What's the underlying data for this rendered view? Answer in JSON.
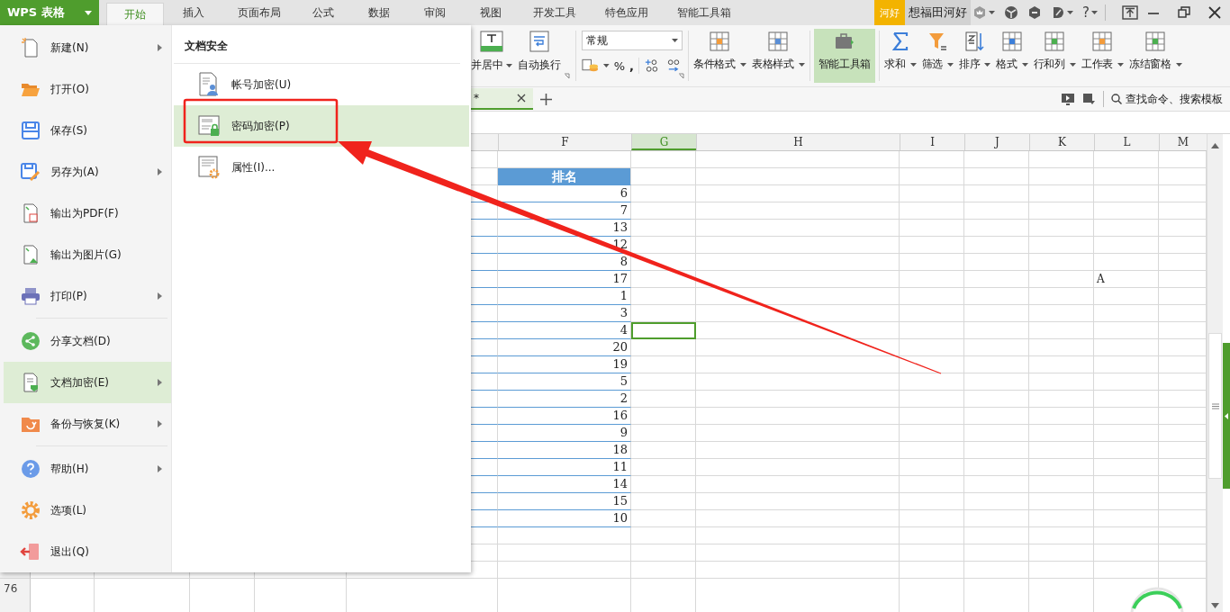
{
  "app_menu": {
    "label": "WPS 表格"
  },
  "tabs": [
    {
      "label": "开始",
      "selected": true
    },
    {
      "label": "插入",
      "selected": false
    },
    {
      "label": "页面布局",
      "selected": false
    },
    {
      "label": "公式",
      "selected": false
    },
    {
      "label": "数据",
      "selected": false
    },
    {
      "label": "审阅",
      "selected": false
    },
    {
      "label": "视图",
      "selected": false
    },
    {
      "label": "开发工具",
      "selected": false
    },
    {
      "label": "特色应用",
      "selected": false
    },
    {
      "label": "智能工具箱",
      "selected": false
    }
  ],
  "account": {
    "badge": "河好",
    "name": "想福田河好",
    "help": "?"
  },
  "ribbon": {
    "merge_center": "并居中",
    "wrap_text": "自动换行",
    "number_format": "常规",
    "percent": "%",
    "comma": ",",
    "buttons": [
      {
        "label": "条件格式",
        "dropdown": true,
        "highlighted": false
      },
      {
        "label": "表格样式",
        "dropdown": true,
        "highlighted": false
      },
      {
        "label": "智能工具箱",
        "dropdown": false,
        "highlighted": true
      },
      {
        "label": "求和",
        "dropdown": true,
        "highlighted": false
      },
      {
        "label": "筛选",
        "dropdown": true,
        "highlighted": false
      },
      {
        "label": "排序",
        "dropdown": true,
        "highlighted": false
      },
      {
        "label": "格式",
        "dropdown": true,
        "highlighted": false
      },
      {
        "label": "行和列",
        "dropdown": true,
        "highlighted": false
      },
      {
        "label": "工作表",
        "dropdown": true,
        "highlighted": false
      },
      {
        "label": "冻结窗格",
        "dropdown": true,
        "highlighted": false
      }
    ]
  },
  "doc_tab": {
    "title": "*",
    "selected": true
  },
  "search": {
    "placeholder": "查找命令、搜索模板"
  },
  "sheet": {
    "columns": [
      {
        "label": "F",
        "selected": false
      },
      {
        "label": "G",
        "selected": true
      },
      {
        "label": "H",
        "selected": false
      },
      {
        "label": "I",
        "selected": false
      },
      {
        "label": "J",
        "selected": false
      },
      {
        "label": "K",
        "selected": false
      },
      {
        "label": "L",
        "selected": false
      },
      {
        "label": "M",
        "selected": false
      }
    ],
    "rows": [
      {
        "kind": "blank",
        "cursor": false
      },
      {
        "kind": "header",
        "F": "排名",
        "cursor": false
      },
      {
        "kind": "data",
        "F": "6",
        "cursor": false
      },
      {
        "kind": "data",
        "F": "7",
        "cursor": false
      },
      {
        "kind": "data",
        "F": "13",
        "cursor": false
      },
      {
        "kind": "data",
        "F": "12",
        "cursor": false
      },
      {
        "kind": "data",
        "F": "8",
        "cursor": false
      },
      {
        "kind": "data",
        "F": "17",
        "L": "A",
        "cursor": false
      },
      {
        "kind": "data",
        "F": "1",
        "cursor": false
      },
      {
        "kind": "data",
        "F": "3",
        "cursor": false
      },
      {
        "kind": "data",
        "F": "4",
        "cursor": true
      },
      {
        "kind": "data",
        "F": "20",
        "cursor": false
      },
      {
        "kind": "data",
        "F": "19",
        "cursor": false
      },
      {
        "kind": "data",
        "F": "5",
        "cursor": false
      },
      {
        "kind": "data",
        "F": "2",
        "cursor": false
      },
      {
        "kind": "data",
        "F": "16",
        "cursor": false
      },
      {
        "kind": "data",
        "F": "9",
        "cursor": false
      },
      {
        "kind": "data",
        "F": "18",
        "cursor": false
      },
      {
        "kind": "data",
        "F": "11",
        "cursor": false
      },
      {
        "kind": "data",
        "F": "14",
        "cursor": false
      },
      {
        "kind": "data",
        "F": "15",
        "cursor": false
      },
      {
        "kind": "data",
        "F": "10",
        "cursor": false
      },
      {
        "kind": "blank",
        "cursor": false
      },
      {
        "kind": "blank",
        "cursor": false
      },
      {
        "kind": "blank",
        "cursor": false
      },
      {
        "kind": "blank",
        "number": "76",
        "cursor": false
      }
    ]
  },
  "file_menu": {
    "items": [
      {
        "label": "新建(N)",
        "submenu": true,
        "selected": false,
        "divider_before": false
      },
      {
        "label": "打开(O)",
        "submenu": false,
        "selected": false,
        "divider_before": false
      },
      {
        "label": "保存(S)",
        "submenu": false,
        "selected": false,
        "divider_before": false
      },
      {
        "label": "另存为(A)",
        "submenu": true,
        "selected": false,
        "divider_before": false
      },
      {
        "label": "输出为PDF(F)",
        "submenu": false,
        "selected": false,
        "divider_before": false
      },
      {
        "label": "输出为图片(G)",
        "submenu": false,
        "selected": false,
        "divider_before": false
      },
      {
        "label": "打印(P)",
        "submenu": true,
        "selected": false,
        "divider_before": false
      },
      {
        "label": "分享文档(D)",
        "submenu": false,
        "selected": false,
        "divider_before": true
      },
      {
        "label": "文档加密(E)",
        "submenu": true,
        "selected": true,
        "divider_before": false
      },
      {
        "label": "备份与恢复(K)",
        "submenu": true,
        "selected": false,
        "divider_before": false
      },
      {
        "label": "帮助(H)",
        "submenu": true,
        "selected": false,
        "divider_before": true
      },
      {
        "label": "选项(L)",
        "submenu": false,
        "selected": false,
        "divider_before": false
      },
      {
        "label": "退出(Q)",
        "submenu": false,
        "selected": false,
        "divider_before": false
      }
    ]
  },
  "submenu": {
    "title": "文档安全",
    "items": [
      {
        "label": "帐号加密(U)",
        "selected": false
      },
      {
        "label": "密码加密(P)",
        "selected": true
      },
      {
        "label": "属性(I)...",
        "selected": false
      }
    ]
  }
}
